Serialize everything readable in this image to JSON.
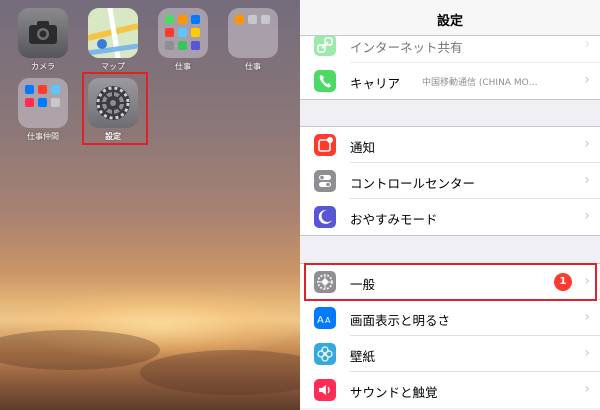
{
  "home": {
    "apps": [
      {
        "name": "camera",
        "label": "カメラ"
      },
      {
        "name": "maps",
        "label": "マップ"
      },
      {
        "name": "folder1",
        "label": "仕事"
      },
      {
        "name": "folder2",
        "label": "仕事"
      },
      {
        "name": "folder3",
        "label": "仕事仲間"
      },
      {
        "name": "settings",
        "label": "設定"
      }
    ]
  },
  "settings": {
    "title": "設定",
    "group1": [
      {
        "label": "インターネット共有",
        "icon": "link-icon",
        "color": "#4cd964"
      },
      {
        "label": "キャリア",
        "detail": "中国移動通信 (CHINA MO…",
        "icon": "phone-icon",
        "color": "#4cd964"
      }
    ],
    "group2": [
      {
        "label": "通知",
        "icon": "notification-icon",
        "color": "#ff3b30"
      },
      {
        "label": "コントロールセンター",
        "icon": "toggle-icon",
        "color": "#8e8e93"
      },
      {
        "label": "おやすみモード",
        "icon": "moon-icon",
        "color": "#5856d6"
      }
    ],
    "group3": [
      {
        "label": "一般",
        "icon": "gear-icon",
        "color": "#8e8e93",
        "badge": "1"
      },
      {
        "label": "画面表示と明るさ",
        "icon": "text-size-icon",
        "color": "#007aff"
      },
      {
        "label": "壁紙",
        "icon": "flower-icon",
        "color": "#34aadc"
      },
      {
        "label": "サウンドと触覚",
        "icon": "speaker-icon",
        "color": "#ff2d55"
      }
    ]
  }
}
